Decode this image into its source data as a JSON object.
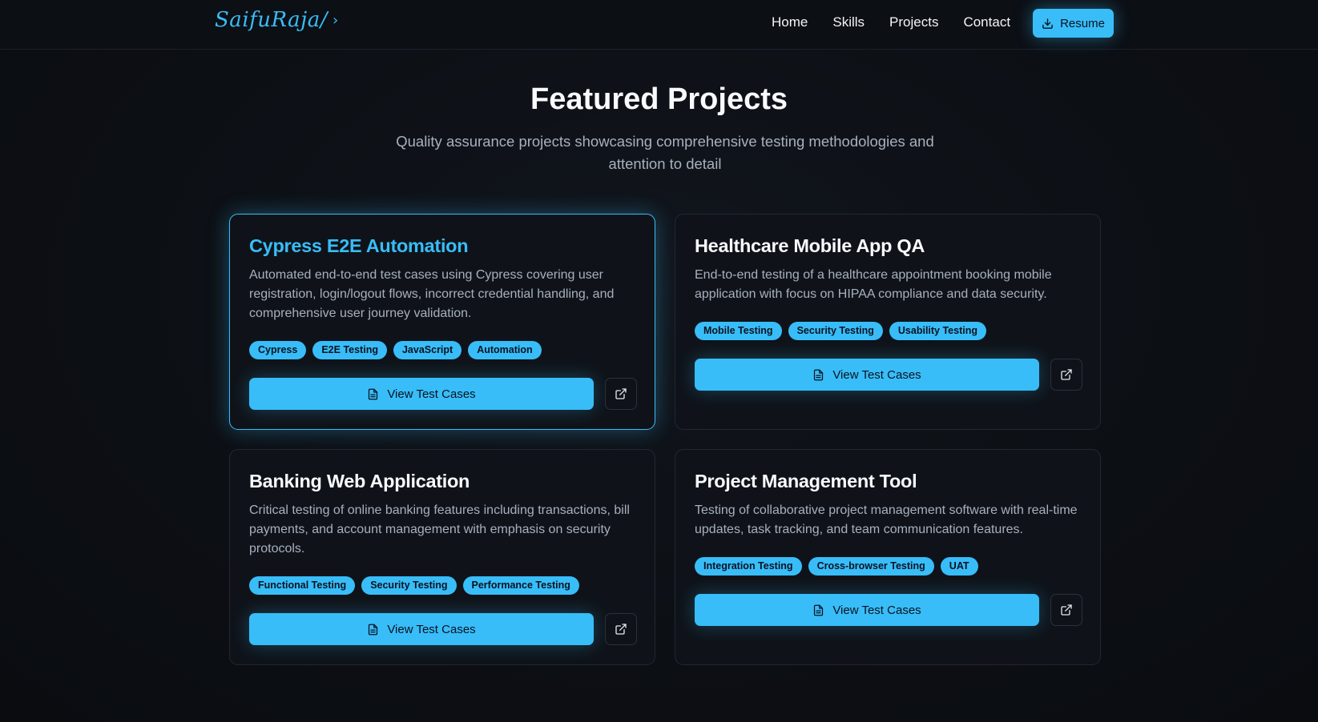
{
  "nav": {
    "logo_text": "SaifuRaja/",
    "logo_chevron": "›",
    "links": [
      "Home",
      "Skills",
      "Projects",
      "Contact"
    ],
    "resume_label": "Resume",
    "resume_icon": "download-icon"
  },
  "section": {
    "title": "Featured Projects",
    "subtitle": "Quality assurance projects showcasing comprehensive testing methodologies and attention to detail"
  },
  "projects": [
    {
      "title": "Cypress E2E Automation",
      "description": "Automated end-to-end test cases using Cypress covering user registration, login/logout flows, incorrect credential handling, and comprehensive user journey validation.",
      "tags": [
        "Cypress",
        "E2E Testing",
        "JavaScript",
        "Automation"
      ],
      "button_label": "View Test Cases",
      "highlighted": true
    },
    {
      "title": "Healthcare Mobile App QA",
      "description": "End-to-end testing of a healthcare appointment booking mobile application with focus on HIPAA compliance and data security.",
      "tags": [
        "Mobile Testing",
        "Security Testing",
        "Usability Testing"
      ],
      "button_label": "View Test Cases",
      "highlighted": false
    },
    {
      "title": "Banking Web Application",
      "description": "Critical testing of online banking features including transactions, bill payments, and account management with emphasis on security protocols.",
      "tags": [
        "Functional Testing",
        "Security Testing",
        "Performance Testing"
      ],
      "button_label": "View Test Cases",
      "highlighted": false
    },
    {
      "title": "Project Management Tool",
      "description": "Testing of collaborative project management software with real-time updates, task tracking, and team communication features.",
      "tags": [
        "Integration Testing",
        "Cross-browser Testing",
        "UAT"
      ],
      "button_label": "View Test Cases",
      "highlighted": false
    }
  ],
  "colors": {
    "accent": "#38bdf8",
    "background": "#0d1015",
    "card": "#0f1319",
    "muted_text": "#a8b0bd"
  }
}
